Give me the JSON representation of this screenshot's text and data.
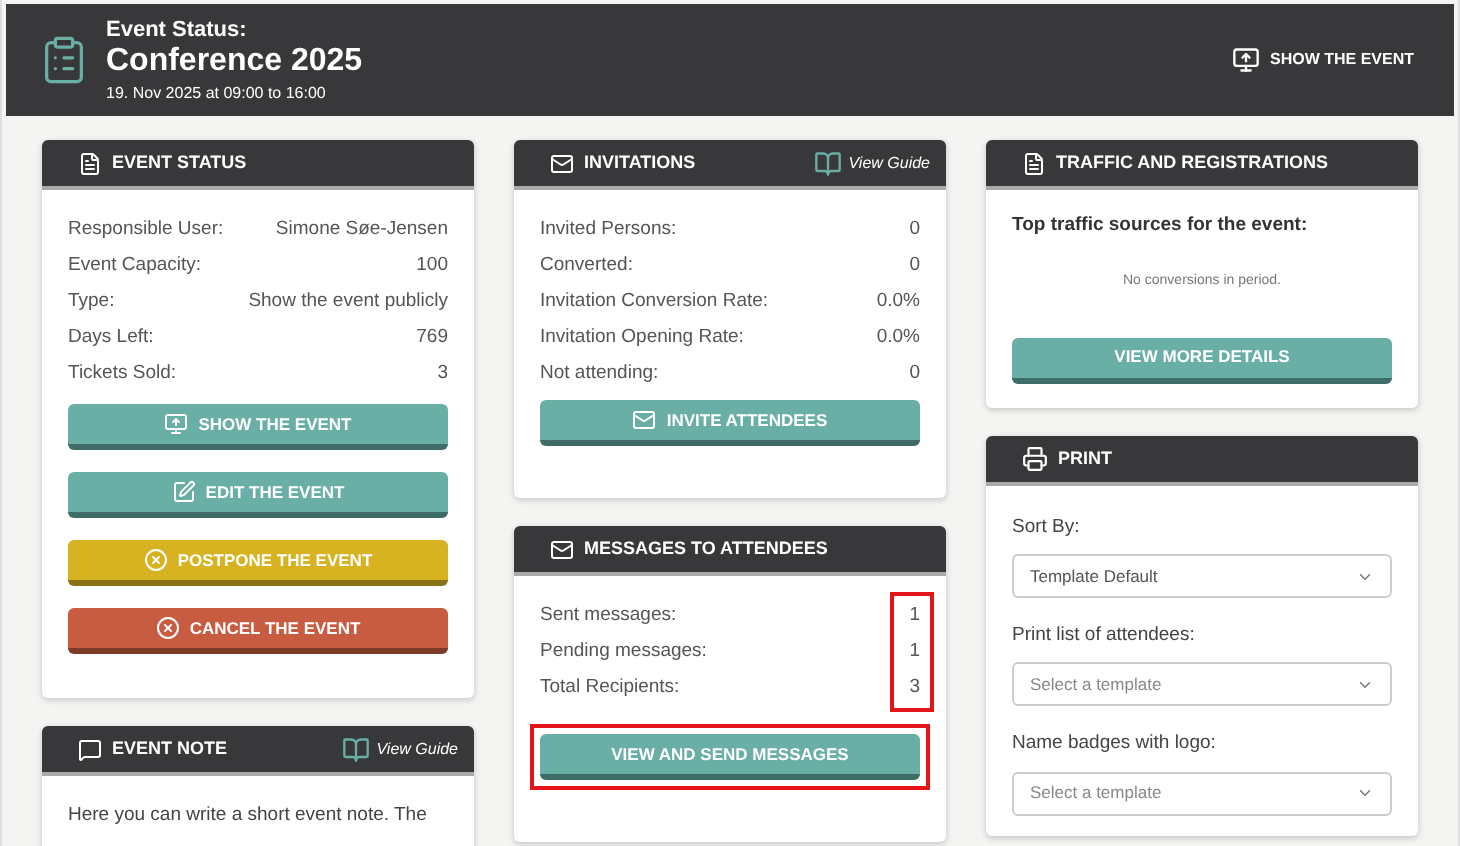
{
  "header": {
    "label": "Event Status:",
    "title": "Conference 2025",
    "date": "19. Nov 2025 at 09:00 to 16:00",
    "action": "SHOW THE EVENT"
  },
  "event_status": {
    "title": "EVENT STATUS",
    "rows": [
      {
        "label": "Responsible User:",
        "value": "Simone Søe-Jensen"
      },
      {
        "label": "Event Capacity:",
        "value": "100"
      },
      {
        "label": "Type:",
        "value": "Show the event publicly"
      },
      {
        "label": "Days Left:",
        "value": "769"
      },
      {
        "label": "Tickets Sold:",
        "value": "3"
      }
    ],
    "buttons": [
      {
        "label": "SHOW THE EVENT",
        "kind": "show"
      },
      {
        "label": "EDIT THE EVENT",
        "kind": "edit"
      },
      {
        "label": "POSTPONE THE EVENT",
        "kind": "postpone"
      },
      {
        "label": "CANCEL THE EVENT",
        "kind": "cancel"
      }
    ]
  },
  "event_note": {
    "title": "EVENT NOTE",
    "guide": "View Guide",
    "text": "Here you can write a short event note. The"
  },
  "invitations": {
    "title": "INVITATIONS",
    "guide": "View Guide",
    "rows": [
      {
        "label": "Invited Persons:",
        "value": "0"
      },
      {
        "label": "Converted:",
        "value": "0"
      },
      {
        "label": "Invitation Conversion Rate:",
        "value": "0.0%"
      },
      {
        "label": "Invitation Opening Rate:",
        "value": "0.0%"
      },
      {
        "label": "Not attending:",
        "value": "0"
      }
    ],
    "button": "INVITE ATTENDEES"
  },
  "messages": {
    "title": "MESSAGES TO ATTENDEES",
    "values_highlighted": true,
    "rows": [
      {
        "label": "Sent messages:",
        "value": "1"
      },
      {
        "label": "Pending messages:",
        "value": "1"
      },
      {
        "label": "Total Recipients:",
        "value": "3"
      }
    ],
    "button": {
      "label": "VIEW AND SEND MESSAGES",
      "highlighted": true
    }
  },
  "traffic": {
    "title": "TRAFFIC AND REGISTRATIONS",
    "subtitle": "Top traffic sources for the event:",
    "empty": "No conversions in period.",
    "button": "VIEW MORE DETAILS"
  },
  "print": {
    "title": "PRINT",
    "fields": [
      {
        "label": "Sort By:",
        "value": "Template Default"
      },
      {
        "label": "Print list of attendees:",
        "placeholder": "Select a template"
      },
      {
        "label": "Name badges with logo:",
        "placeholder": "Select a template"
      }
    ]
  }
}
